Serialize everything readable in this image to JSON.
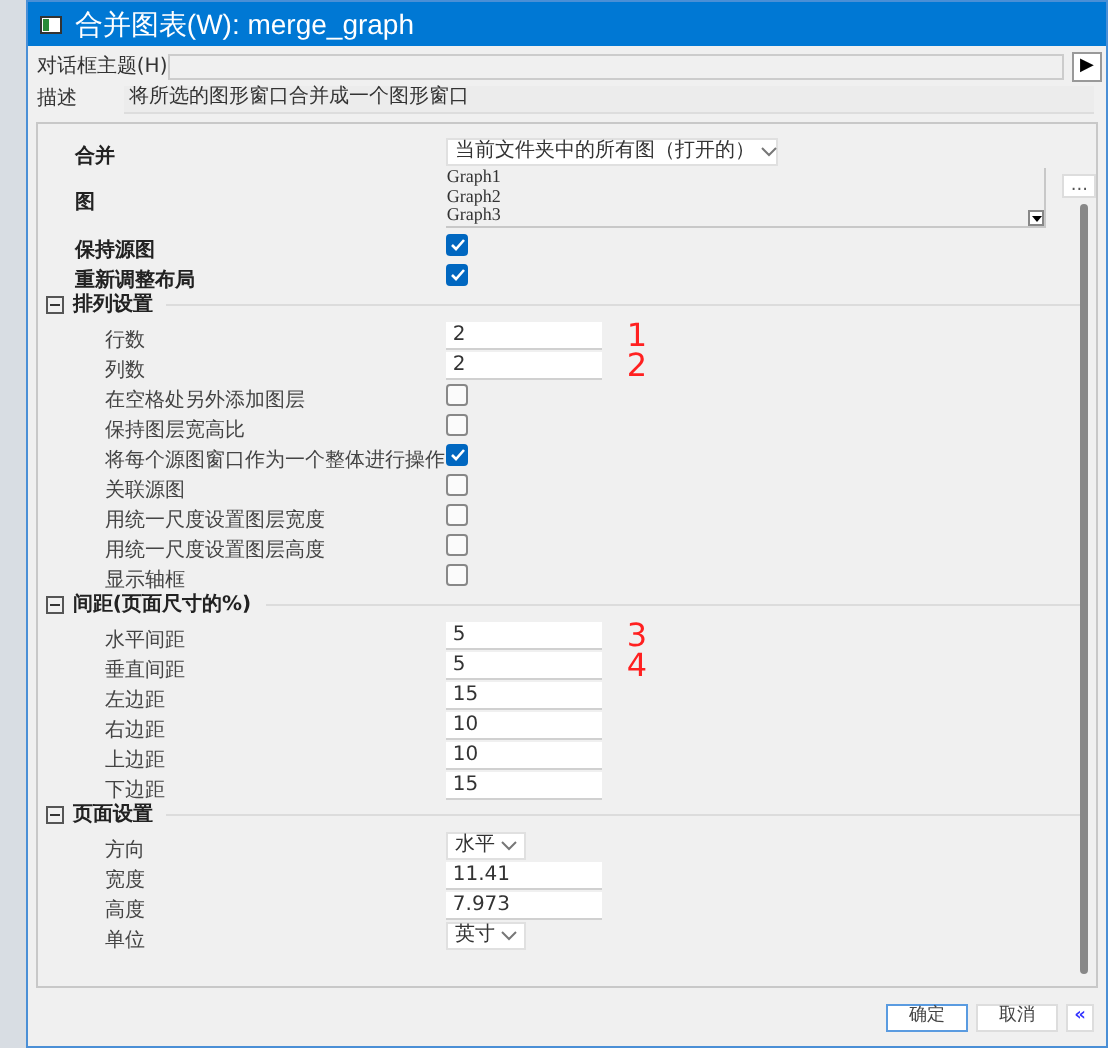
{
  "window": {
    "title": "合并图表(W): merge_graph"
  },
  "theme": {
    "label": "对话框主题(H)",
    "button": "▶"
  },
  "description": {
    "label": "描述",
    "text": "将所选的图形窗口合并成一个图形窗口"
  },
  "panel": [
    {
      "kind": "select",
      "label": "合并",
      "value": "当前文件夹中的所有图（打开的）"
    },
    {
      "kind": "list",
      "label": "图",
      "items": [
        "Graph1",
        "Graph2",
        "Graph3"
      ],
      "button": "..."
    },
    {
      "kind": "checkbox",
      "label": "保持源图",
      "checked": true
    },
    {
      "kind": "checkbox",
      "label": "重新调整布局",
      "checked": true
    },
    {
      "kind": "section",
      "label": "排列设置",
      "expanded": true,
      "children": [
        {
          "kind": "field",
          "label": "行数",
          "value": "2",
          "note": "1"
        },
        {
          "kind": "field",
          "label": "列数",
          "value": "2",
          "note": "2"
        },
        {
          "kind": "checkbox",
          "label": "在空格处另外添加图层",
          "checked": false
        },
        {
          "kind": "checkbox",
          "label": "保持图层宽高比",
          "checked": false
        },
        {
          "kind": "checkbox",
          "label": "将每个源图窗口作为一个整体进行操作",
          "checked": true
        },
        {
          "kind": "checkbox",
          "label": "关联源图",
          "checked": false
        },
        {
          "kind": "checkbox",
          "label": "用统一尺度设置图层宽度",
          "checked": false
        },
        {
          "kind": "checkbox",
          "label": "用统一尺度设置图层高度",
          "checked": false
        },
        {
          "kind": "checkbox",
          "label": "显示轴框",
          "checked": false
        }
      ]
    },
    {
      "kind": "section",
      "label": "间距(页面尺寸的%)",
      "expanded": true,
      "children": [
        {
          "kind": "field",
          "label": "水平间距",
          "value": "5",
          "note": "3"
        },
        {
          "kind": "field",
          "label": "垂直间距",
          "value": "5",
          "note": "4"
        },
        {
          "kind": "field",
          "label": "左边距",
          "value": "15"
        },
        {
          "kind": "field",
          "label": "右边距",
          "value": "10"
        },
        {
          "kind": "field",
          "label": "上边距",
          "value": "10"
        },
        {
          "kind": "field",
          "label": "下边距",
          "value": "15"
        }
      ]
    },
    {
      "kind": "section",
      "label": "页面设置",
      "expanded": true,
      "children": [
        {
          "kind": "combo",
          "label": "方向",
          "value": "水平"
        },
        {
          "kind": "field",
          "label": "宽度",
          "value": "11.41"
        },
        {
          "kind": "field",
          "label": "高度",
          "value": "7.973"
        },
        {
          "kind": "combo",
          "label": "单位",
          "value": "英寸"
        }
      ]
    }
  ],
  "buttons": [
    {
      "label": "确定",
      "kind": "primary"
    },
    {
      "label": "取消",
      "kind": "normal"
    },
    {
      "label": "«",
      "kind": "toggle"
    }
  ]
}
